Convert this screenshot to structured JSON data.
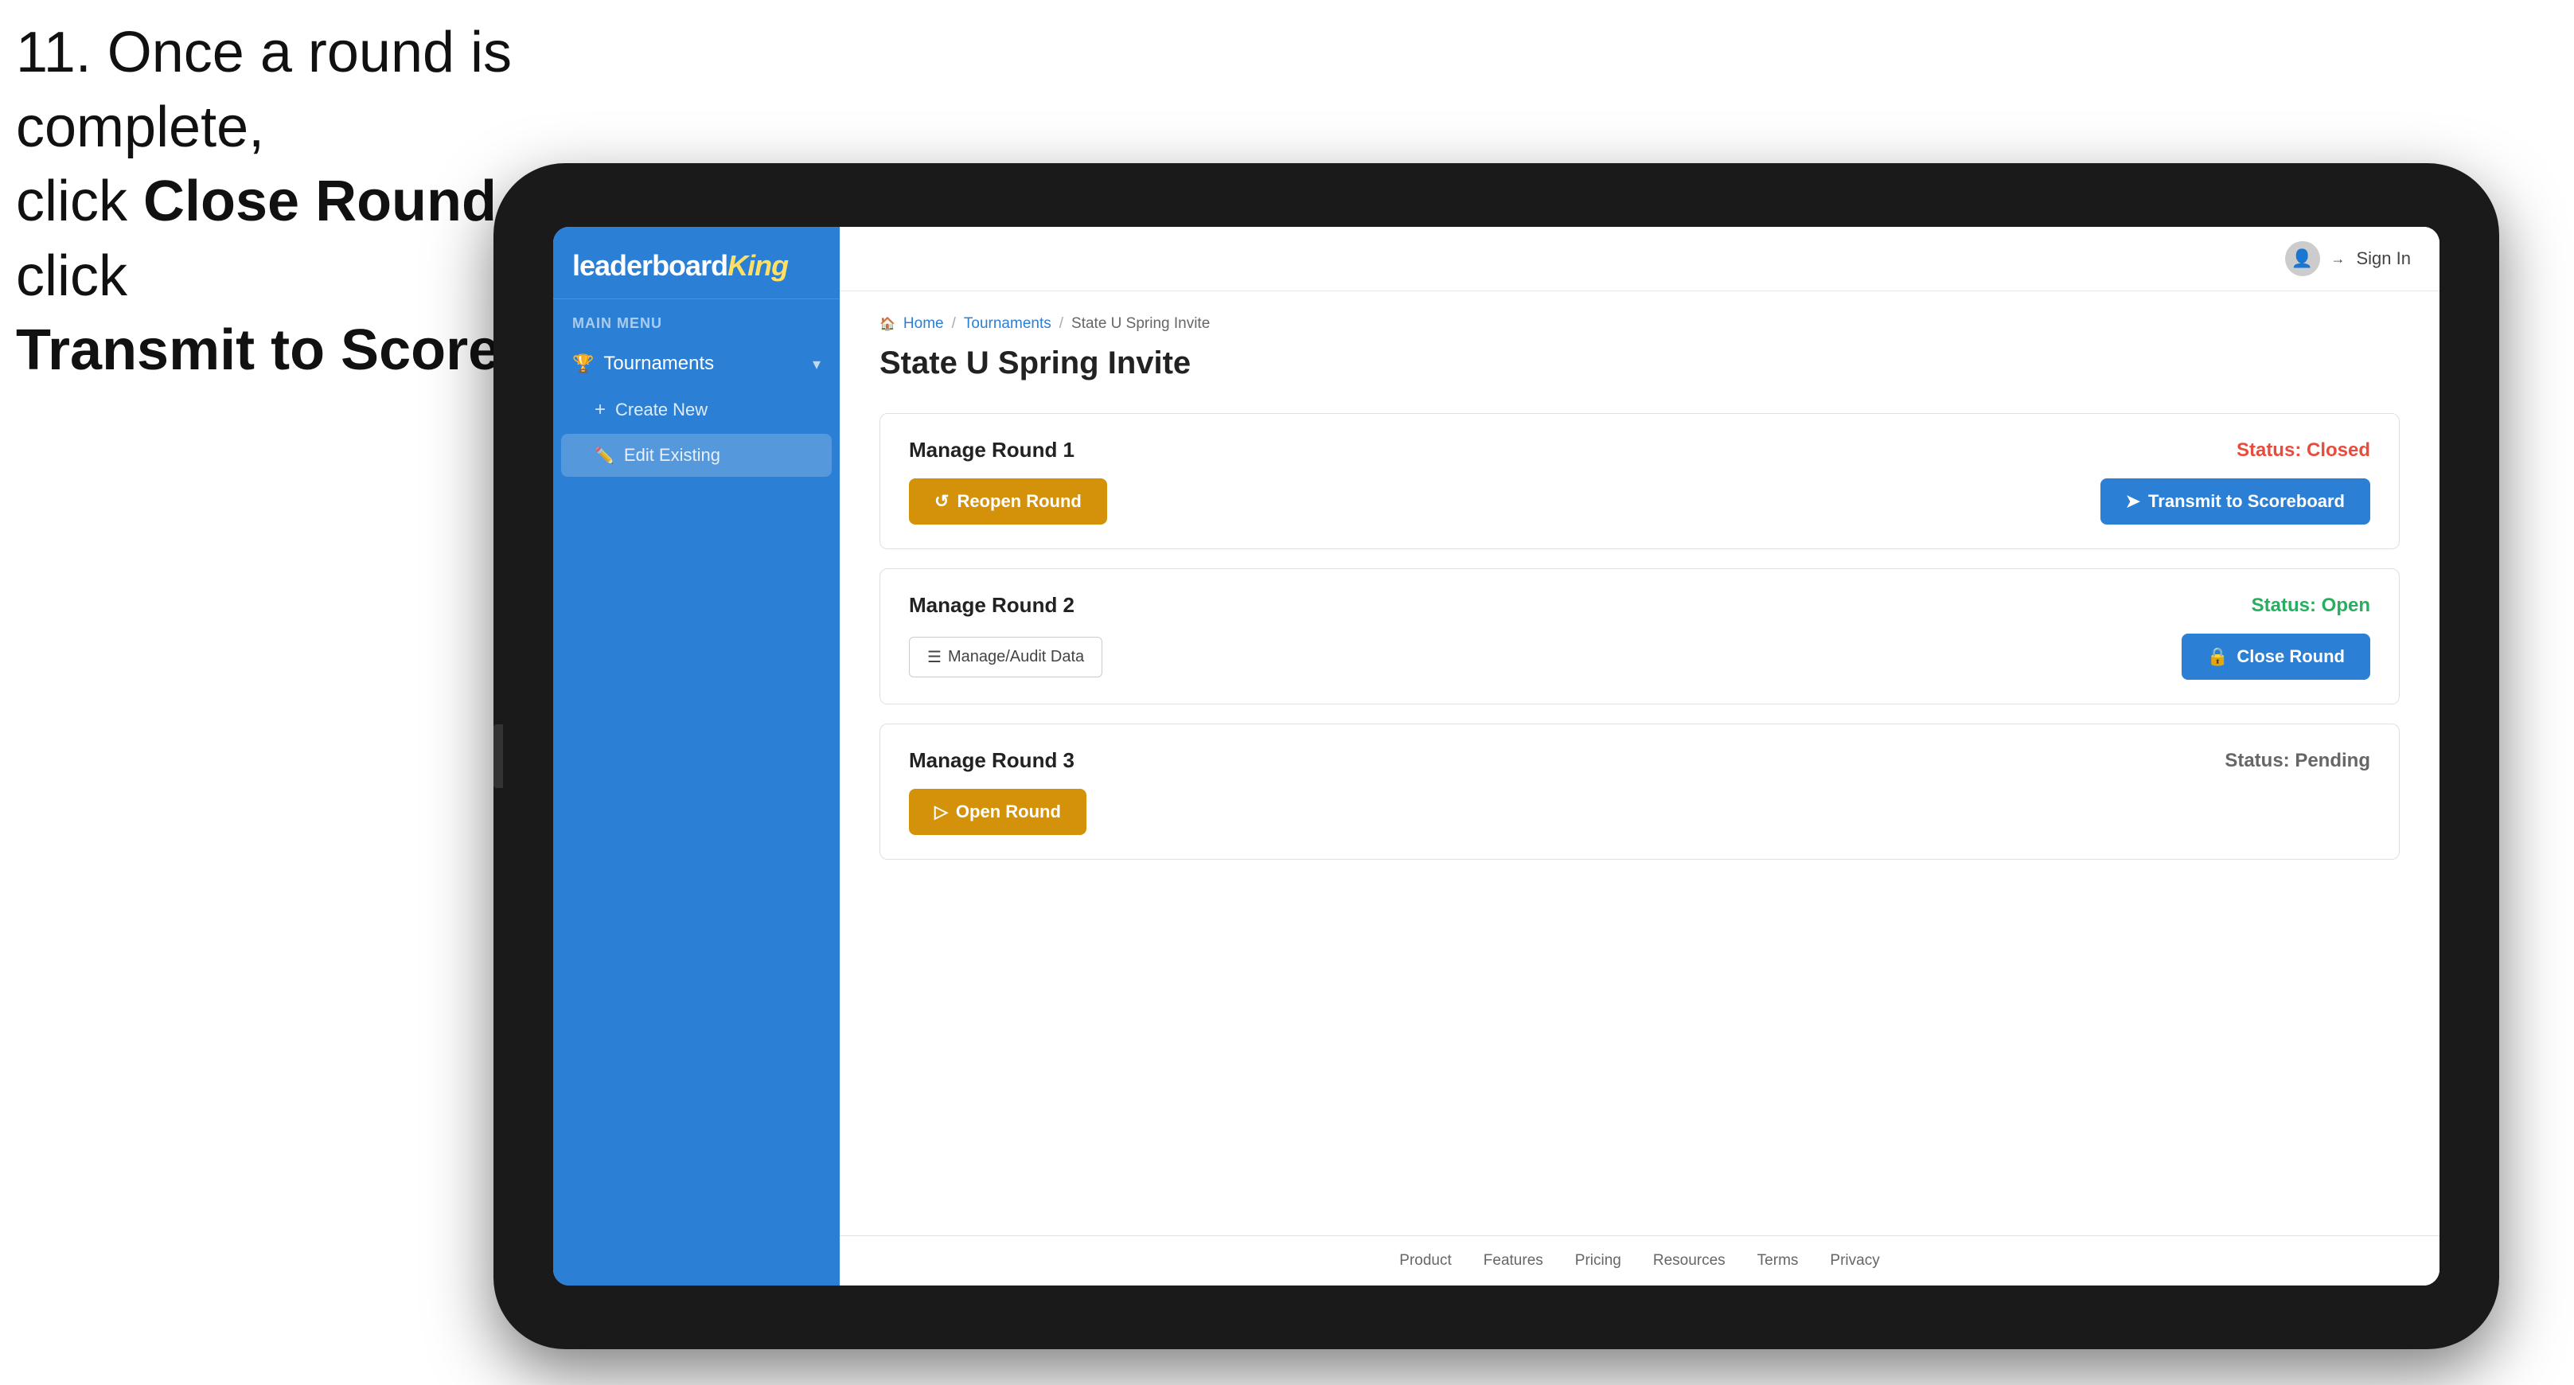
{
  "instruction": {
    "line1": "11. Once a round is complete,",
    "line2_prefix": "click ",
    "line2_bold": "Close Round",
    "line2_suffix": " then click",
    "line3": "Transmit to Scoreboard."
  },
  "app": {
    "logo_text": "leaderboard",
    "logo_king": "King"
  },
  "sidebar": {
    "main_menu_label": "MAIN MENU",
    "nav_items": [
      {
        "label": "Tournaments",
        "has_dropdown": true
      }
    ],
    "sub_items": [
      {
        "label": "Create New",
        "active": false
      },
      {
        "label": "Edit Existing",
        "active": true
      }
    ]
  },
  "topbar": {
    "sign_in": "Sign In"
  },
  "breadcrumb": {
    "home": "Home",
    "separator1": "/",
    "tournaments": "Tournaments",
    "separator2": "/",
    "current": "State U Spring Invite"
  },
  "page": {
    "title": "State U Spring Invite"
  },
  "rounds": [
    {
      "title": "Manage Round 1",
      "status_label": "Status:",
      "status_value": "Closed",
      "status_class": "status-closed",
      "left_button": {
        "label": "Reopen Round",
        "style": "gold",
        "icon": "↺"
      },
      "right_button": {
        "label": "Transmit to Scoreboard",
        "style": "blue",
        "icon": "➤"
      }
    },
    {
      "title": "Manage Round 2",
      "status_label": "Status:",
      "status_value": "Open",
      "status_class": "status-open",
      "left_button": {
        "label": "Manage/Audit Data",
        "style": "outline",
        "icon": "☰"
      },
      "right_button": {
        "label": "Close Round",
        "style": "blue",
        "icon": "🔒"
      }
    },
    {
      "title": "Manage Round 3",
      "status_label": "Status:",
      "status_value": "Pending",
      "status_class": "status-pending",
      "left_button": {
        "label": "Open Round",
        "style": "gold",
        "icon": "▷"
      },
      "right_button": null
    }
  ],
  "footer": {
    "links": [
      "Product",
      "Features",
      "Pricing",
      "Resources",
      "Terms",
      "Privacy"
    ]
  },
  "colors": {
    "blue": "#2b7fd4",
    "gold": "#d4920a",
    "red_arrow": "#e8174a"
  }
}
